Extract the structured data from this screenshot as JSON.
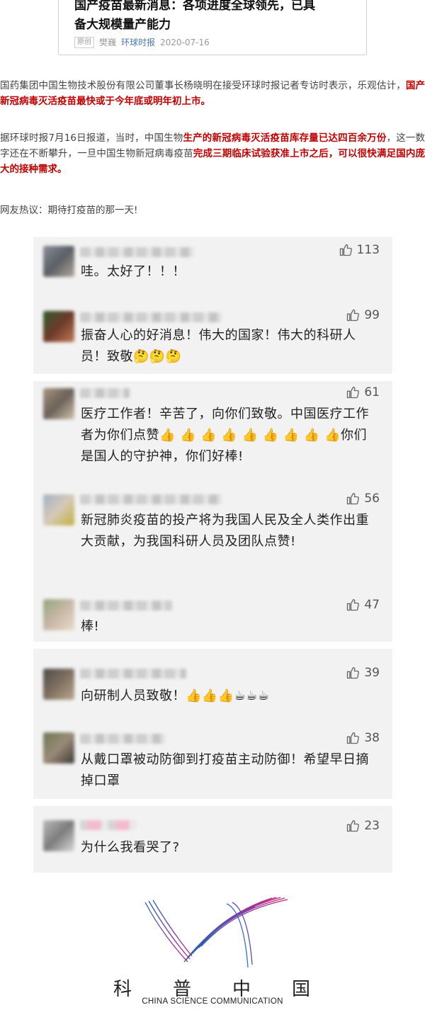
{
  "card": {
    "title_line1": "国产疫苗最新消息：各项进度全球领先，已具",
    "title_line2": "备大规模量产能力",
    "badge": "原创",
    "author": "樊巍",
    "source": "环球时报",
    "date": "2020-07-16"
  },
  "para1": {
    "normal": "国药集团中国生物技术股份有限公司董事长杨晓明在接受环球时报记者专访时表示，乐观估计，",
    "highlight": "国产新冠病毒灭活疫苗最快或于今年底或明年初上市。"
  },
  "para2": {
    "p1": "据环球时报7月16日报道，当时，中国生物",
    "h1": "生产的新冠病毒灭活疫苗库存量已达四百余万份",
    "p2": "，这一数字还在不断攀升，一旦中国生物新冠病毒疫苗",
    "h2": "完成三期临床试验获准上市之后，可以很快满足国内庞大的接种需求。"
  },
  "para3": "网友热议：期待打疫苗的那一天!",
  "comments": [
    {
      "likes": "113",
      "text": "哇。太好了！！！"
    },
    {
      "likes": "99",
      "text": "振奋人心的好消息！伟大的国家！伟大的科研人员！致敬"
    },
    {
      "likes": "61",
      "text_a": "医疗工作者！辛苦了，向你们致敬。中国医疗工作者为你们点赞",
      "text_b": "你们是国人的守护神，你们好棒!"
    },
    {
      "likes": "56",
      "text": "新冠肺炎疫苗的投产将为我国人民及全人类作出重大贡献，为我国科研人员及团队点赞!"
    },
    {
      "likes": "47",
      "text": "棒!"
    },
    {
      "likes": "39",
      "text": "向研制人员致敬！"
    },
    {
      "likes": "38",
      "text": "从戴口罩被动防御到打疫苗主动防御！希望早日摘掉口罩"
    },
    {
      "likes": "23",
      "text": "为什么我看哭了?"
    }
  ],
  "logo": {
    "cn": [
      "科",
      "普",
      "中",
      "国"
    ],
    "en": "CHINA SCIENCE COMMUNICATION"
  },
  "colors": {
    "highlight": "#c00000",
    "comment_bg": "#f2f2f2",
    "source_link": "#4a7ab0"
  }
}
